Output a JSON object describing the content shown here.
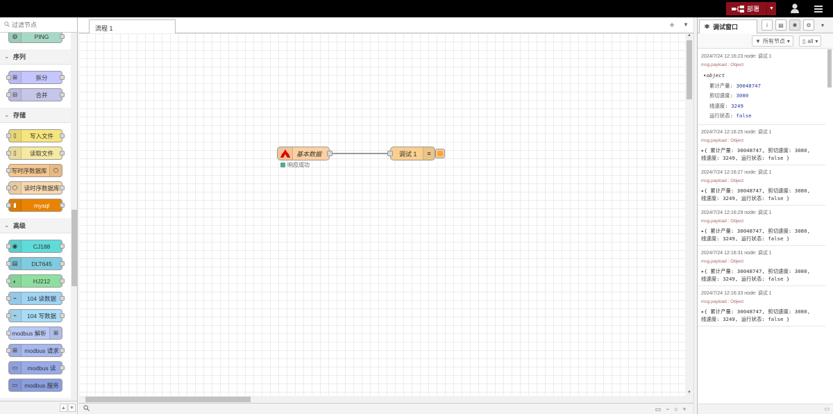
{
  "header": {
    "deploy_label": "部署",
    "brand_color": "#8c101c"
  },
  "palette": {
    "search_placeholder": "过滤节点",
    "top_node": "PING",
    "categories": [
      {
        "title": "序列",
        "nodes": [
          "拆分",
          "合并"
        ]
      },
      {
        "title": "存储",
        "nodes": [
          "写入文件",
          "读取文件",
          "写时序数据库",
          "读时序数据库",
          "mysql"
        ]
      },
      {
        "title": "高级",
        "nodes": [
          "CJ188",
          "DLT645",
          "HJ212",
          "104 读数据",
          "104 写数据",
          "modbus 解析",
          "modbus 请求",
          "modbus 读",
          "modbus 服务"
        ]
      }
    ]
  },
  "workspace": {
    "tab_label": "流程 1",
    "nodes": {
      "source_label": "基本数据",
      "source_status": "响应成功",
      "debug_label": "调试 1"
    }
  },
  "sidebar": {
    "tab_label": "调试窗口",
    "filter_label": "所有节点",
    "clear_label": "all",
    "messages": [
      {
        "meta": "2024/7/24 12:16:23  node: 调试 1",
        "topic": "msg.payload : Object",
        "expanded": true,
        "object_label": "object",
        "fields": [
          {
            "k": "累计产量",
            "v": "30048747"
          },
          {
            "k": "剪切速度",
            "v": "3080"
          },
          {
            "k": "线速度",
            "v": "3249"
          },
          {
            "k": "运行状态",
            "v": "false"
          }
        ]
      },
      {
        "meta": "2024/7/24 12:16:25  node: 调试 1",
        "topic": "msg.payload : Object",
        "line1": "▸{ 累计产量: 30048747, 剪切速度: 3080,",
        "line2": "线速度: 3249, 运行状态: false }"
      },
      {
        "meta": "2024/7/24 12:16:27  node: 调试 1",
        "topic": "msg.payload : Object",
        "line1": "▸{ 累计产量: 30048747, 剪切速度: 3080,",
        "line2": "线速度: 3249, 运行状态: false }"
      },
      {
        "meta": "2024/7/24 12:16:29  node: 调试 1",
        "topic": "msg.payload : Object",
        "line1": "▸{ 累计产量: 30048747, 剪切速度: 3080,",
        "line2": "线速度: 3249, 运行状态: false }"
      },
      {
        "meta": "2024/7/24 12:16:31  node: 调试 1",
        "topic": "msg.payload : Object",
        "line1": "▸{ 累计产量: 30048747, 剪切速度: 3080,",
        "line2": "线速度: 3249, 运行状态: false }"
      },
      {
        "meta": "2024/7/24 12:16:33  node: 调试 1",
        "topic": "msg.payload : Object",
        "line1": "▸{ 累计产量: 30048747, 剪切速度: 3080,",
        "line2": "线速度: 3249, 运行状态: false }"
      }
    ]
  }
}
